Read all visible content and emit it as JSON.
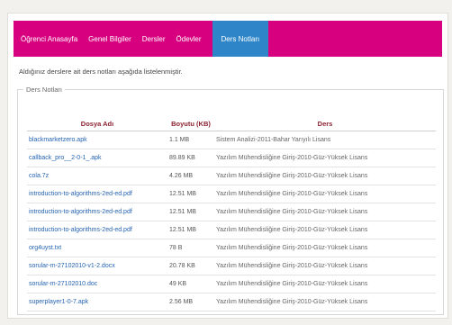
{
  "nav": {
    "items": [
      {
        "label": "Öğrenci Anasayfa"
      },
      {
        "label": "Genel Bilgiler"
      },
      {
        "label": "Dersler"
      },
      {
        "label": "Ödevler"
      },
      {
        "label": "Ders Notları"
      }
    ],
    "active_index": 4,
    "accent_color": "#d7007f",
    "active_color": "#2e86c9"
  },
  "intro_text": "Aldığınız derslere ait ders notları aşağıda listelenmiştir.",
  "files_panel": {
    "legend": "Ders Notları",
    "columns": [
      "Dosya Adı",
      "Boyutu (KB)",
      "Ders"
    ],
    "rows": [
      {
        "name": "blackmarketzero.apk",
        "size": "1.1 MB",
        "course": "Sistem Analizi-2011-Bahar Yarıyılı Lisans"
      },
      {
        "name": "callback_pro__2-0-1_.apk",
        "size": "89.89 KB",
        "course": "Yazılım Mühendisliğine Giriş-2010-Güz-Yüksek Lisans"
      },
      {
        "name": "cola.7z",
        "size": "4.26 MB",
        "course": "Yazılım Mühendisliğine Giriş-2010-Güz-Yüksek Lisans"
      },
      {
        "name": "introduction-to-algorithms-2ed-ed.pdf",
        "size": "12.51 MB",
        "course": "Yazılım Mühendisliğine Giriş-2010-Güz-Yüksek Lisans"
      },
      {
        "name": "introduction-to-algorithms-2ed-ed.pdf",
        "size": "12.51 MB",
        "course": "Yazılım Mühendisliğine Giriş-2010-Güz-Yüksek Lisans"
      },
      {
        "name": "introduction-to-algorithms-2ed-ed.pdf",
        "size": "12.51 MB",
        "course": "Yazılım Mühendisliğine Giriş-2010-Güz-Yüksek Lisans"
      },
      {
        "name": "org4uyst.txt",
        "size": "78 B",
        "course": "Yazılım Mühendisliğine Giriş-2010-Güz-Yüksek Lisans"
      },
      {
        "name": "sorular-m-27102010-v1-2.docx",
        "size": "20.78 KB",
        "course": "Yazılım Mühendisliğine Giriş-2010-Güz-Yüksek Lisans"
      },
      {
        "name": "sorular-m-27102010.doc",
        "size": "49 KB",
        "course": "Yazılım Mühendisliğine Giriş-2010-Güz-Yüksek Lisans"
      },
      {
        "name": "superplayer1-0-7.apk",
        "size": "2.56 MB",
        "course": "Yazılım Mühendisliğine Giriş-2010-Güz-Yüksek Lisans"
      }
    ]
  }
}
